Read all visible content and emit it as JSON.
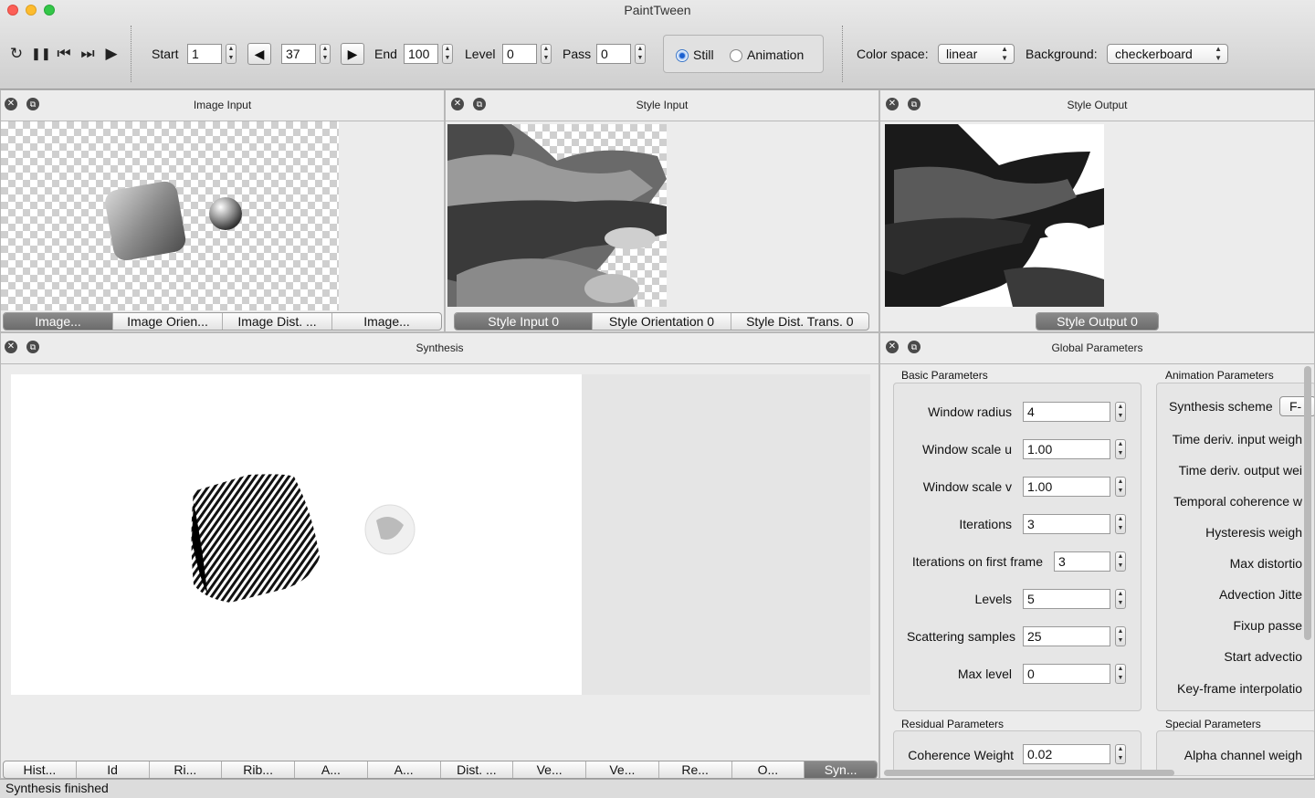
{
  "window": {
    "title": "PaintTween"
  },
  "toolbar": {
    "start_label": "Start",
    "start_value": "1",
    "current_frame": "37",
    "end_label": "End",
    "end_value": "100",
    "level_label": "Level",
    "level_value": "0",
    "pass_label": "Pass",
    "pass_value": "0",
    "mode_still": "Still",
    "mode_animation": "Animation",
    "mode_selected": "Still",
    "colorspace_label": "Color space:",
    "colorspace_value": "linear",
    "background_label": "Background:",
    "background_value": "checkerboard",
    "icons": [
      "refresh-icon",
      "pause-icon",
      "step-back-icon",
      "step-forward-icon",
      "play-icon"
    ]
  },
  "panels": {
    "image_input": {
      "title": "Image Input",
      "tabs": [
        "Image...",
        "Image Orien...",
        "Image Dist. ...",
        "Image..."
      ],
      "selected": 0
    },
    "style_input": {
      "title": "Style Input",
      "tabs": [
        "Style Input 0",
        "Style Orientation 0",
        "Style Dist. Trans. 0"
      ],
      "selected": 0
    },
    "style_output": {
      "title": "Style Output",
      "tabs": [
        "Style Output 0"
      ],
      "selected": 0
    },
    "synthesis": {
      "title": "Synthesis",
      "tabs": [
        "Hist...",
        "Id",
        "Ri...",
        "Rib...",
        "A...",
        "A...",
        "Dist. ...",
        "Ve...",
        "Ve...",
        "Re...",
        "O...",
        "Syn..."
      ],
      "selected": 11
    },
    "global": {
      "title": "Global Parameters",
      "basic_title": "Basic Parameters",
      "basic": [
        {
          "label": "Window radius",
          "value": "4"
        },
        {
          "label": "Window scale u",
          "value": "1.00"
        },
        {
          "label": "Window scale v",
          "value": "1.00"
        },
        {
          "label": "Iterations",
          "value": "3"
        },
        {
          "label": "Iterations on first frame",
          "value": "3"
        },
        {
          "label": "Levels",
          "value": "5"
        },
        {
          "label": "Scattering samples",
          "value": "25"
        },
        {
          "label": "Max level",
          "value": "0"
        }
      ],
      "animation_title": "Animation Parameters",
      "animation": [
        "Synthesis scheme",
        "Time deriv. input weigh",
        "Time deriv. output wei",
        "Temporal coherence w",
        "Hysteresis weigh",
        "Max distortio",
        "Advection Jitte",
        "Fixup passe",
        "Start advectio",
        "Key-frame interpolatio"
      ],
      "synthesis_scheme_value": "F-",
      "residual_title": "Residual Parameters",
      "residual": [
        {
          "label": "Coherence Weight",
          "value": "0.02"
        }
      ],
      "special_title": "Special Parameters",
      "special": [
        "Alpha channel weigh"
      ]
    }
  },
  "status": {
    "text": "Synthesis finished"
  }
}
